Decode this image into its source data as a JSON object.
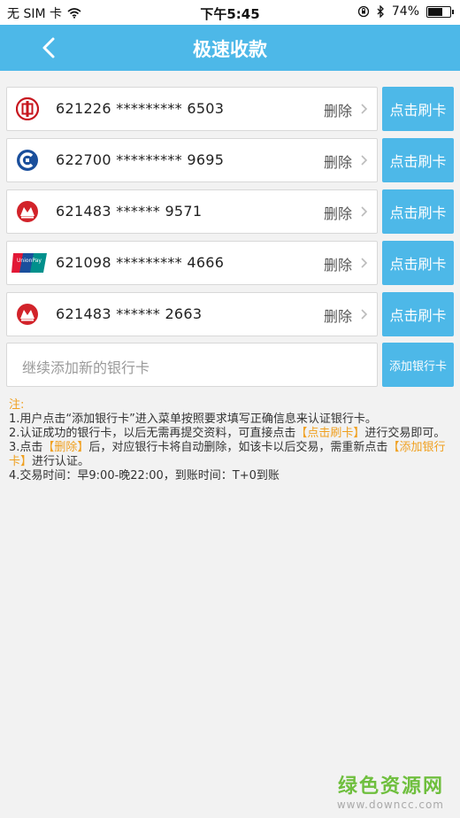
{
  "status_bar": {
    "carrier": "无 SIM 卡",
    "time": "下午5:45",
    "battery_percent": "74%",
    "battery_level": 0.74
  },
  "nav": {
    "title": "极速收款"
  },
  "cards": [
    {
      "number": "621226 ********* 6503",
      "delete_label": "删除",
      "swipe_label": "点击刷卡",
      "bank_icon": "icbc-logo-icon"
    },
    {
      "number": "622700 ********* 9695",
      "delete_label": "删除",
      "swipe_label": "点击刷卡",
      "bank_icon": "ccb-logo-icon"
    },
    {
      "number": "621483 ****** 9571",
      "delete_label": "删除",
      "swipe_label": "点击刷卡",
      "bank_icon": "cmb-logo-icon"
    },
    {
      "number": "621098 ********* 4666",
      "delete_label": "删除",
      "swipe_label": "点击刷卡",
      "bank_icon": "unionpay-logo-icon"
    },
    {
      "number": "621483 ****** 2663",
      "delete_label": "删除",
      "swipe_label": "点击刷卡",
      "bank_icon": "cmb-logo-icon"
    }
  ],
  "add_card": {
    "placeholder": "继续添加新的银行卡",
    "button_label": "添加银行卡"
  },
  "notes": {
    "title": "注:",
    "line1": "1.用户点击“添加银行卡”进入菜单按照要求填写正确信息来认证银行卡。",
    "line2_a": "2.认证成功的银行卡，以后无需再提交资料，可直接点击",
    "line2_hl": "【点击刷卡】",
    "line2_b": "进行交易即可。",
    "line3_a": "3.点击",
    "line3_hl1": "【删除】",
    "line3_b": "后，对应银行卡将自动删除，如该卡以后交易，需重新点击",
    "line3_hl2": "【添加银行卡】",
    "line3_c": "进行认证。",
    "line4": "4.交易时间：早9:00-晚22:00，到账时间：T+0到账"
  },
  "watermark": {
    "cn": "绿色资源网",
    "url": "www.downcc.com"
  },
  "colors": {
    "accent": "#4db8e8",
    "highlight": "#f0a020",
    "icbc_red": "#c7161e",
    "ccb_blue": "#1a4f9c"
  }
}
